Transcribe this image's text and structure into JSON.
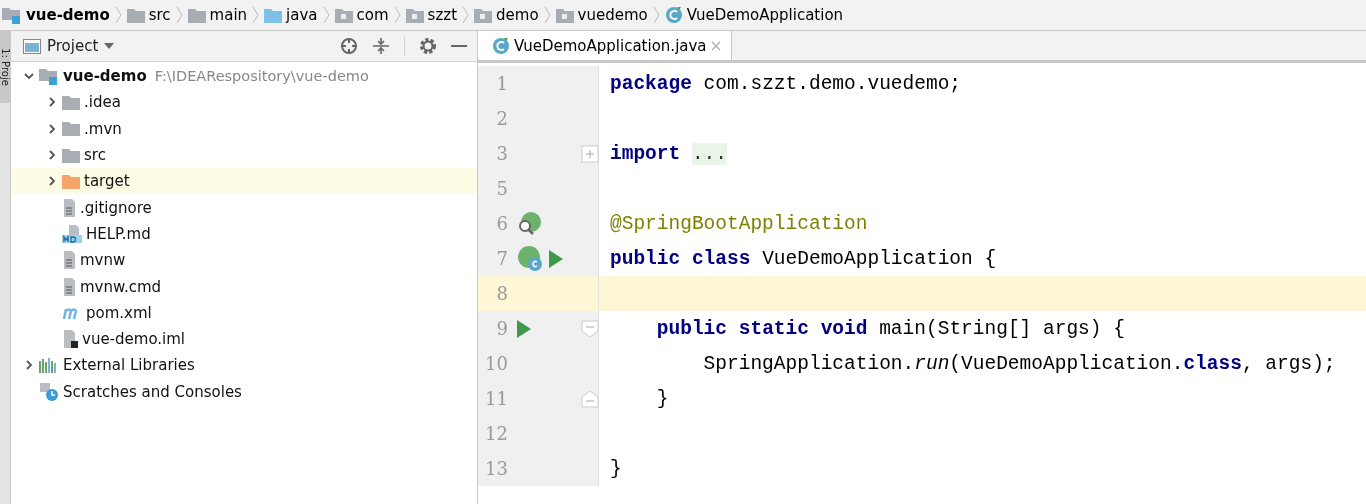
{
  "breadcrumbs": [
    {
      "label": "vue-demo",
      "kind": "module",
      "bold": true
    },
    {
      "label": "src",
      "kind": "folder",
      "bold": false
    },
    {
      "label": "main",
      "kind": "folder",
      "bold": false
    },
    {
      "label": "java",
      "kind": "source-folder",
      "bold": false
    },
    {
      "label": "com",
      "kind": "package",
      "bold": false
    },
    {
      "label": "szzt",
      "kind": "package",
      "bold": false
    },
    {
      "label": "demo",
      "kind": "package",
      "bold": false
    },
    {
      "label": "vuedemo",
      "kind": "package",
      "bold": false
    },
    {
      "label": "VueDemoApplication",
      "kind": "class",
      "bold": false
    }
  ],
  "side_tab": {
    "label": "1: Proje"
  },
  "project_panel": {
    "title": "Project",
    "tree": [
      {
        "label": "vue-demo",
        "path": "F:\\IDEARespository\\vue-demo",
        "kind": "module",
        "expanded": true,
        "selected": false,
        "children": [
          {
            "label": ".idea",
            "kind": "folder",
            "expanded": false,
            "selected": false
          },
          {
            "label": ".mvn",
            "kind": "folder",
            "expanded": false,
            "selected": false
          },
          {
            "label": "src",
            "kind": "folder",
            "expanded": false,
            "selected": false
          },
          {
            "label": "target",
            "kind": "excluded-folder",
            "expanded": false,
            "selected": true
          },
          {
            "label": ".gitignore",
            "kind": "file",
            "selected": false
          },
          {
            "label": "HELP.md",
            "kind": "markdown",
            "selected": false
          },
          {
            "label": "mvnw",
            "kind": "file",
            "selected": false
          },
          {
            "label": "mvnw.cmd",
            "kind": "file",
            "selected": false
          },
          {
            "label": "pom.xml",
            "kind": "maven",
            "selected": false
          },
          {
            "label": "vue-demo.iml",
            "kind": "iml",
            "selected": false
          }
        ]
      },
      {
        "label": "External Libraries",
        "kind": "libraries",
        "expanded": false,
        "selected": false
      },
      {
        "label": "Scratches and Consoles",
        "kind": "scratches",
        "selected": false
      }
    ]
  },
  "editor": {
    "tab": {
      "label": "VueDemoApplication.java",
      "kind": "class",
      "selected": true
    },
    "lines": [
      {
        "number": "1",
        "current": false,
        "tokens": [
          {
            "kind": "keyword",
            "text": "package"
          },
          {
            "kind": "plain",
            "text": " com.szzt.demo.vuedemo;"
          }
        ]
      },
      {
        "number": "2",
        "current": false
      },
      {
        "number": "3",
        "current": false,
        "kind": "folded",
        "tokens": [
          {
            "kind": "keyword",
            "text": "import "
          },
          {
            "kind": "folded",
            "text": "..."
          }
        ]
      },
      {
        "number": "5",
        "current": false
      },
      {
        "number": "6",
        "current": false,
        "kind": "bean-search",
        "tokens": [
          {
            "kind": "annotation",
            "text": "@SpringBootApplication"
          }
        ]
      },
      {
        "number": "7",
        "current": false,
        "kind": "bean-class-run",
        "tokens": [
          {
            "kind": "keyword",
            "text": "public "
          },
          {
            "kind": "keyword",
            "text": "class"
          },
          {
            "kind": "plain",
            "text": " VueDemoApplication {"
          }
        ]
      },
      {
        "number": "8",
        "current": true
      },
      {
        "number": "9",
        "current": false,
        "kind": "run-fold-start",
        "tokens": [
          {
            "kind": "keyword",
            "text": "    public "
          },
          {
            "kind": "keyword",
            "text": "static "
          },
          {
            "kind": "keyword",
            "text": "void"
          },
          {
            "kind": "plain",
            "text": " main(String[] args) {"
          }
        ]
      },
      {
        "number": "10",
        "current": false,
        "tokens": [
          {
            "kind": "plain",
            "text": "        SpringApplication."
          },
          {
            "kind": "static-call",
            "text": "run"
          },
          {
            "kind": "plain",
            "text": "(VueDemoApplication."
          },
          {
            "kind": "keyword",
            "text": "class"
          },
          {
            "kind": "plain",
            "text": ", args);"
          }
        ]
      },
      {
        "number": "11",
        "current": false,
        "kind": "fold-end",
        "tokens": [
          {
            "kind": "plain",
            "text": "    }"
          }
        ]
      },
      {
        "number": "12",
        "current": false
      },
      {
        "number": "13",
        "current": false,
        "tokens": [
          {
            "kind": "plain",
            "text": "}"
          }
        ]
      }
    ]
  }
}
